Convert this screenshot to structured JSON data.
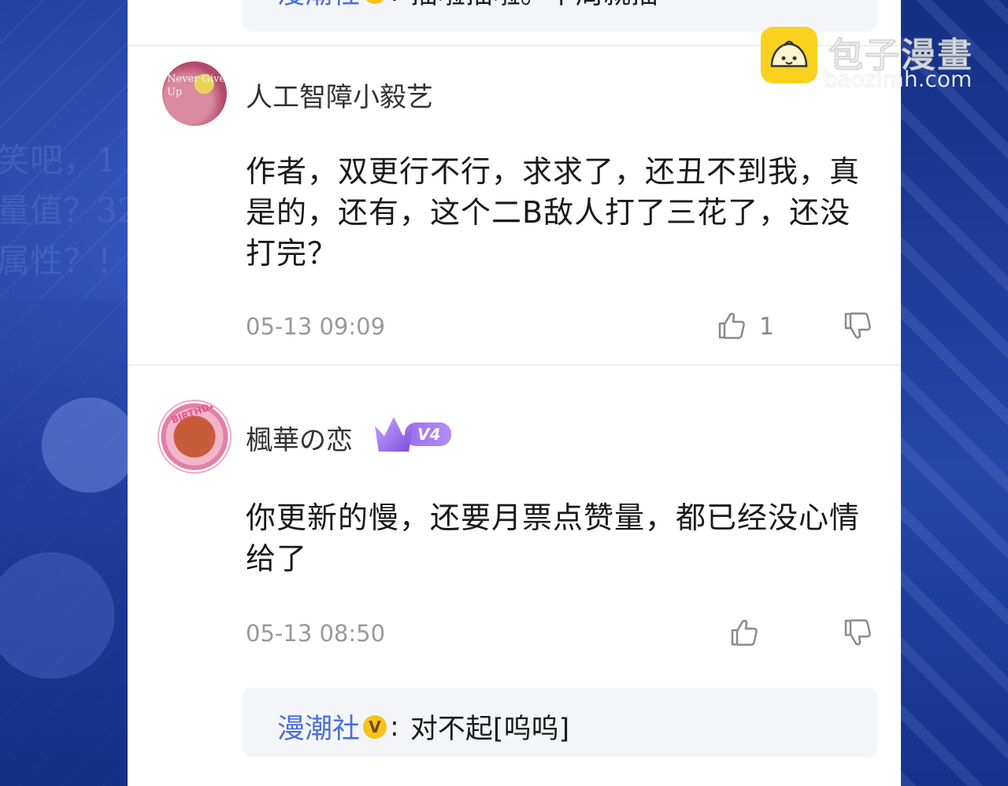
{
  "top_reply": {
    "author": "漫潮社",
    "verified": "V",
    "colon": ":",
    "text": "插啦插啦。下周就插"
  },
  "comments": [
    {
      "username": "人工智障小毅艺",
      "avatar_text": "Never Give Up",
      "body": "作者，双更行不行，求求了，还丑不到我，真是的，还有，这个二B敌人打了三花了，还没打完？",
      "time": "05-13 09:09",
      "likes": "1"
    },
    {
      "username": "楓華の恋",
      "avatar_text": "BIRTHDAY",
      "level": "V4",
      "body": "你更新的慢，还要月票点赞量，都已经没心情给了",
      "time": "05-13 08:50",
      "reply": {
        "author": "漫潮社",
        "verified": "V",
        "colon": ":",
        "text": "对不起[呜呜]"
      }
    }
  ],
  "watermark": {
    "title": "包子漫畫",
    "url": "baozimh.com"
  },
  "background": {
    "left_text": "笑吧，1\n量值？32\n属性？！"
  },
  "colors": {
    "accent": "#4a6fd8",
    "verified": "#f6c31a",
    "level": "#9b6cf0"
  }
}
